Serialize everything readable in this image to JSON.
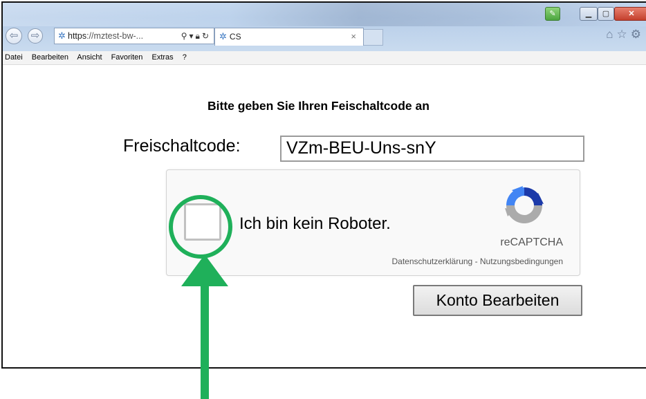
{
  "browser": {
    "address_scheme": "https",
    "address_rest": "://mztest-bw-...",
    "tab_title": "CS",
    "tab_close": "×",
    "menu": [
      "Datei",
      "Bearbeiten",
      "Ansicht",
      "Favoriten",
      "Extras",
      "?"
    ],
    "icons": {
      "back": "back-arrow-icon",
      "forward": "forward-arrow-icon",
      "site": "site-favicon-icon",
      "search": "search-icon",
      "lock": "lock-icon",
      "refresh": "refresh-icon",
      "home": "home-icon",
      "favorites": "star-icon",
      "settings": "gear-icon"
    }
  },
  "page": {
    "heading": "Bitte geben Sie Ihren Feischaltcode an",
    "code_label": "Freischaltcode:",
    "code_value": "VZm-BEU-Uns-snY",
    "captcha": {
      "checkbox_label": "Ich bin kein Roboter.",
      "brand": "reCAPTCHA",
      "terms": "Datenschutzerklärung - Nutzungsbedingungen",
      "checked": false
    },
    "submit_label": "Konto Bearbeiten"
  },
  "annotation": {
    "color": "#1fb05a",
    "highlights": "captcha-checkbox"
  }
}
